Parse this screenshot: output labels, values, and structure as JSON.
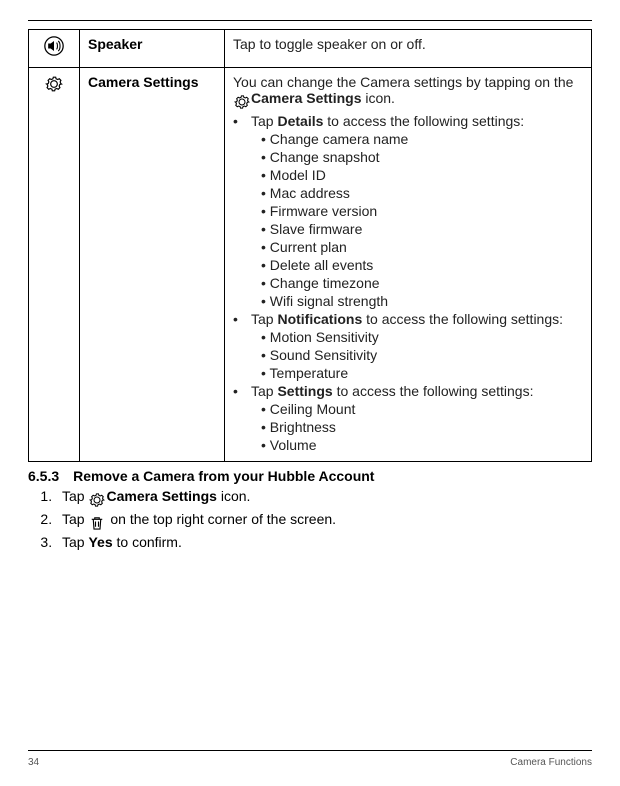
{
  "rows": [
    {
      "name": "Speaker",
      "desc_plain": "Tap to toggle speaker on or off."
    },
    {
      "name": "Camera Settings",
      "desc_intro_1": "You can change the Camera settings by tapping on the ",
      "desc_intro_bold": "Camera Settings",
      "desc_intro_2": " icon.",
      "bullets": [
        {
          "pre": "Tap ",
          "bold": "Details",
          "post": " to access the following settings:",
          "subs": [
            "Change camera name",
            "Change snapshot",
            "Model ID",
            "Mac address",
            "Firmware version",
            "Slave firmware",
            "Current plan",
            "Delete all events",
            "Change timezone",
            "Wifi signal strength"
          ]
        },
        {
          "pre": "Tap ",
          "bold": "Notifications",
          "post": " to access the following settings:",
          "subs": [
            "Motion Sensitivity",
            "Sound Sensitivity",
            "Temperature"
          ]
        },
        {
          "pre": "Tap ",
          "bold": "Settings",
          "post": " to access the following settings:",
          "subs": [
            "Ceiling Mount",
            "Brightness",
            "Volume"
          ]
        }
      ]
    }
  ],
  "section": {
    "number": "6.5.3",
    "title": "Remove a Camera from your Hubble Account",
    "steps": [
      {
        "pre": "Tap ",
        "icon": "gear",
        "bold": "Camera Settings",
        "post": " icon."
      },
      {
        "pre": "Tap  ",
        "icon": "trash",
        "bold": "",
        "post": " on the top right corner of the screen."
      },
      {
        "pre": "Tap ",
        "icon": "",
        "bold": "Yes",
        "post": " to confirm."
      }
    ]
  },
  "footer": {
    "page": "34",
    "label": "Camera Functions"
  }
}
